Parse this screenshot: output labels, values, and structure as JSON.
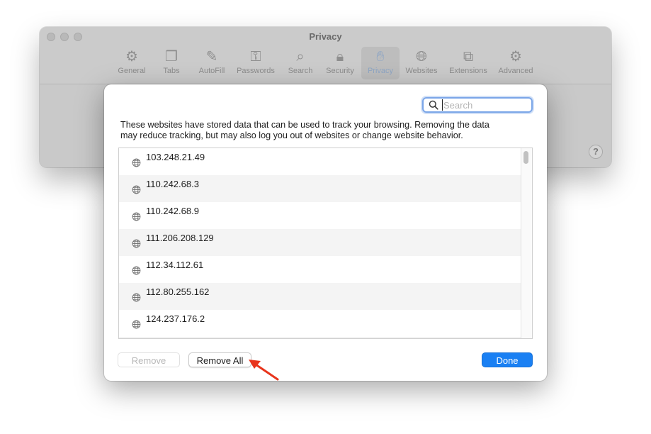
{
  "window": {
    "title": "Privacy",
    "toolbar": [
      {
        "label": "General",
        "icon": "gear-icon"
      },
      {
        "label": "Tabs",
        "icon": "tabs-icon"
      },
      {
        "label": "AutoFill",
        "icon": "pencil-field-icon"
      },
      {
        "label": "Passwords",
        "icon": "key-icon"
      },
      {
        "label": "Search",
        "icon": "search-icon"
      },
      {
        "label": "Security",
        "icon": "lock-icon"
      },
      {
        "label": "Privacy",
        "icon": "hand-icon",
        "active": true
      },
      {
        "label": "Websites",
        "icon": "globe-icon"
      },
      {
        "label": "Extensions",
        "icon": "puzzle-icon"
      },
      {
        "label": "Advanced",
        "icon": "gears-icon"
      }
    ],
    "help": "?"
  },
  "sheet": {
    "search": {
      "placeholder": "Search",
      "value": ""
    },
    "description_line1": "These websites have stored data that can be used to track your browsing. Removing the data",
    "description_line2": "may reduce tracking, but may also log you out of websites or change website behavior.",
    "websites": [
      "103.248.21.49",
      "110.242.68.3",
      "110.242.68.9",
      "111.206.208.129",
      "112.34.112.61",
      "112.80.255.162",
      "124.237.176.2"
    ],
    "buttons": {
      "remove": "Remove",
      "remove_all": "Remove All",
      "done": "Done"
    },
    "accent_color": "#1a80f3",
    "annotation_color": "#e8341c"
  }
}
